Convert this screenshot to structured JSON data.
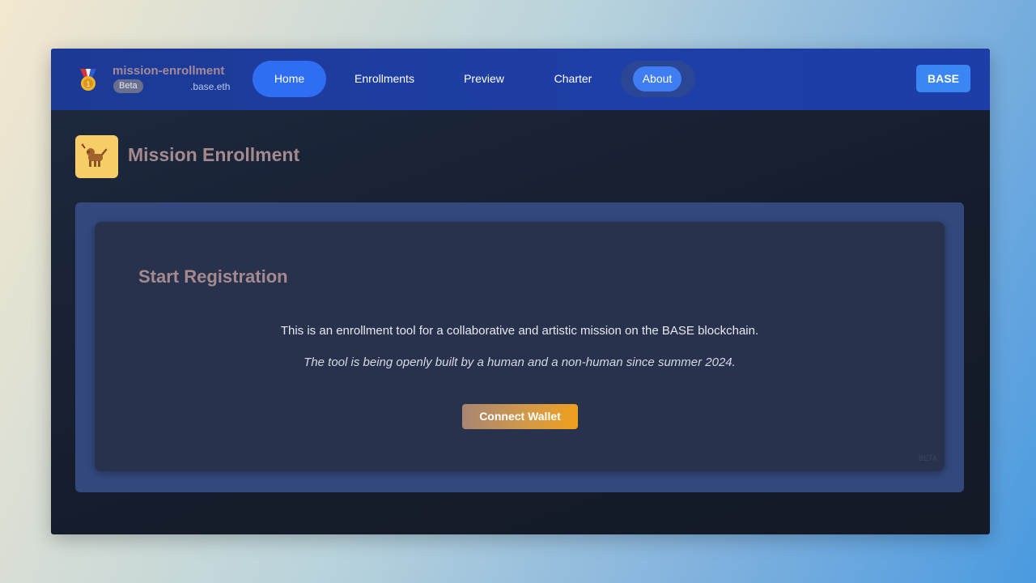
{
  "navbar": {
    "brand_name": "mission-enrollment",
    "beta_label": "Beta",
    "brand_suffix": ".base.eth",
    "items": [
      {
        "label": "Home",
        "active": true
      },
      {
        "label": "Enrollments"
      },
      {
        "label": "Preview"
      },
      {
        "label": "Charter"
      },
      {
        "label": "About"
      }
    ],
    "network_button": "BASE",
    "brand_icon": "medal-icon"
  },
  "page": {
    "title": "Mission Enrollment",
    "icon": "dog-icon"
  },
  "card": {
    "heading": "Start Registration",
    "description": "This is an enrollment tool for a collaborative and artistic mission on the BASE blockchain.",
    "note": "The tool is being openly built by a human and a non-human since summer 2024.",
    "connect_button": "Connect Wallet",
    "corner_label": "BETA"
  },
  "colors": {
    "navbar": "#1e3fa8",
    "active_nav": "#2f6ef2",
    "accent_button": "#3a86f5",
    "title_text": "#a48a8e",
    "connect_gradient_end": "#ef9f1c"
  }
}
